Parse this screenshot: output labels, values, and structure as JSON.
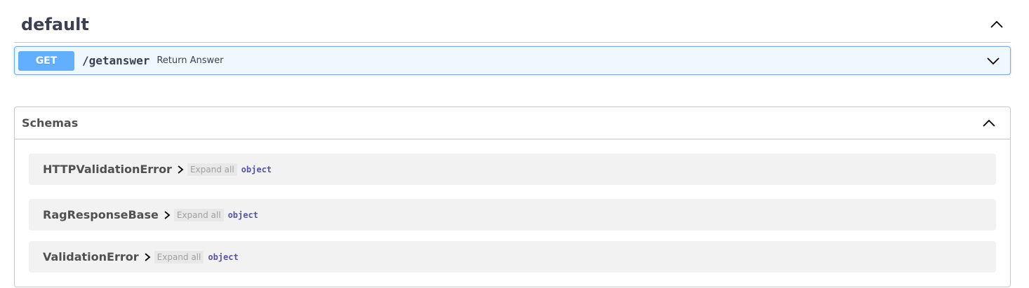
{
  "tag": {
    "title": "default"
  },
  "operation": {
    "method": "GET",
    "path": "/getanswer",
    "summary": "Return Answer"
  },
  "schemas": {
    "title": "Schemas",
    "items": [
      {
        "name": "HTTPValidationError",
        "expand_label": "Expand all",
        "type": "object"
      },
      {
        "name": "RagResponseBase",
        "expand_label": "Expand all",
        "type": "object"
      },
      {
        "name": "ValidationError",
        "expand_label": "Expand all",
        "type": "object"
      }
    ]
  },
  "colors": {
    "get_method": "#61affe",
    "type_text": "#5555aa",
    "text": "#3b4151"
  }
}
